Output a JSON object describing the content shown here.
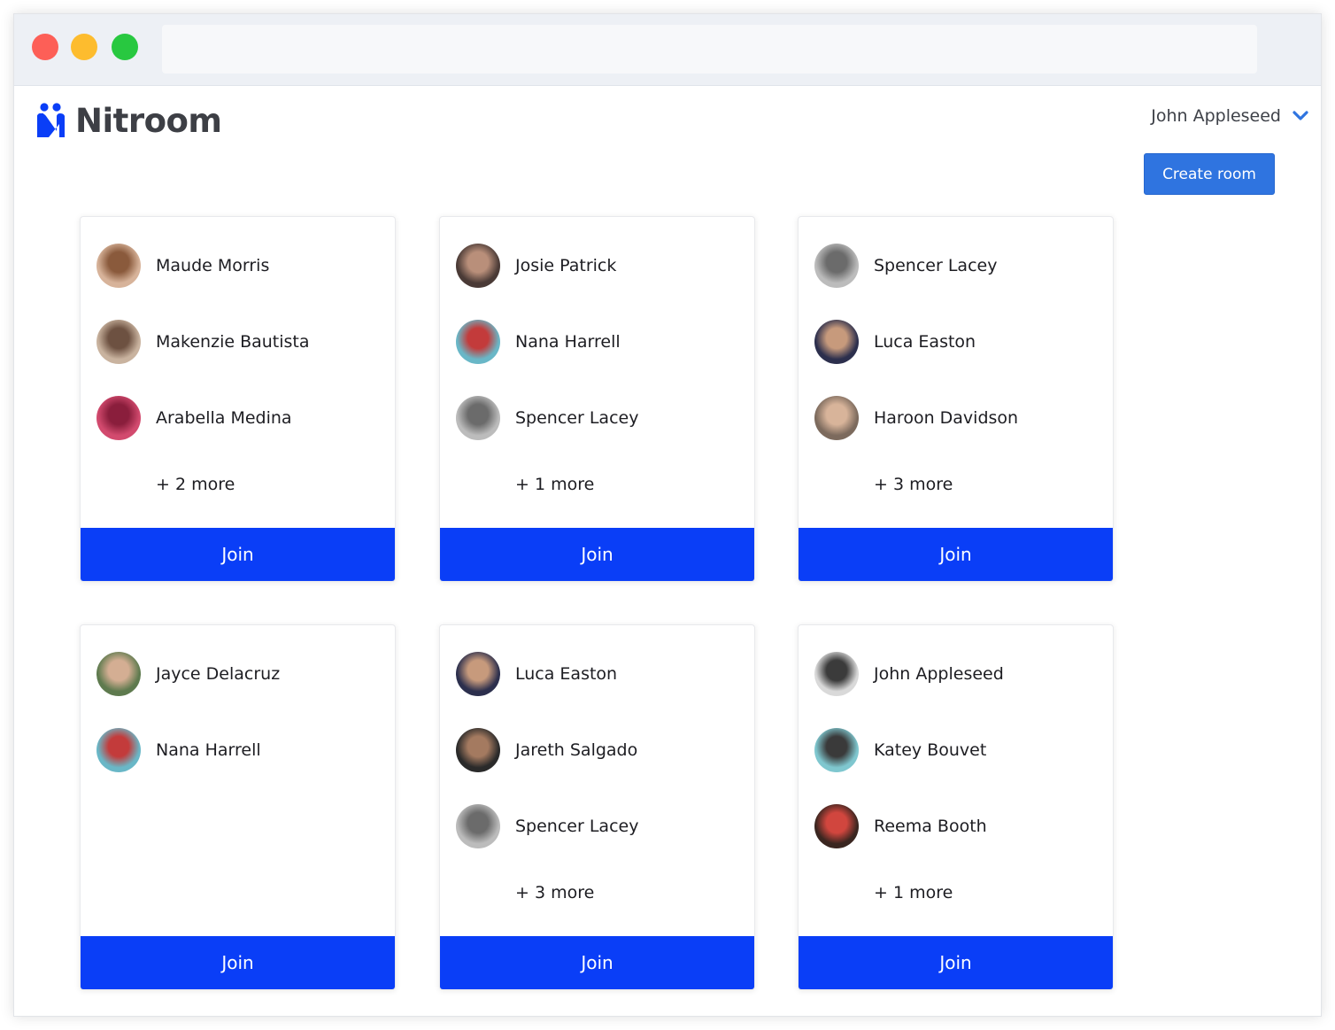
{
  "app": {
    "name": "Nitroom"
  },
  "header": {
    "user_name": "John Appleseed",
    "create_room_label": "Create room"
  },
  "colors": {
    "brand": "#0a3ef7",
    "create_button": "#2f74e0",
    "logo_text": "#3d3f45"
  },
  "rooms": [
    {
      "members": [
        {
          "name": "Maude Morris",
          "avatar_color": "#d7b39a",
          "avatar_accent": "#8a5a3c"
        },
        {
          "name": "Makenzie Bautista",
          "avatar_color": "#c9b39f",
          "avatar_accent": "#6d5141"
        },
        {
          "name": "Arabella Medina",
          "avatar_color": "#d24a6e",
          "avatar_accent": "#8a1e3c"
        }
      ],
      "more": "+ 2 more",
      "join_label": "Join"
    },
    {
      "members": [
        {
          "name": "Josie Patrick",
          "avatar_color": "#4a3a36",
          "avatar_accent": "#b98f7a"
        },
        {
          "name": "Nana Harrell",
          "avatar_color": "#69b7c7",
          "avatar_accent": "#c33b3b"
        },
        {
          "name": "Spencer Lacey",
          "avatar_color": "#bcbcbc",
          "avatar_accent": "#6b6b6b"
        }
      ],
      "more": "+ 1 more",
      "join_label": "Join"
    },
    {
      "members": [
        {
          "name": "Spencer Lacey",
          "avatar_color": "#bcbcbc",
          "avatar_accent": "#6b6b6b"
        },
        {
          "name": "Luca Easton",
          "avatar_color": "#2c2f4d",
          "avatar_accent": "#c79a7c"
        },
        {
          "name": "Haroon Davidson",
          "avatar_color": "#7c6a5d",
          "avatar_accent": "#d8b49a"
        }
      ],
      "more": "+ 3 more",
      "join_label": "Join"
    },
    {
      "members": [
        {
          "name": "Jayce Delacruz",
          "avatar_color": "#5e7a4e",
          "avatar_accent": "#d4ae93"
        },
        {
          "name": "Nana Harrell",
          "avatar_color": "#69b7c7",
          "avatar_accent": "#c33b3b"
        }
      ],
      "more": "",
      "join_label": "Join"
    },
    {
      "members": [
        {
          "name": "Luca Easton",
          "avatar_color": "#2c2f4d",
          "avatar_accent": "#c79a7c"
        },
        {
          "name": "Jareth Salgado",
          "avatar_color": "#2a2a2a",
          "avatar_accent": "#a47a60"
        },
        {
          "name": "Spencer Lacey",
          "avatar_color": "#bcbcbc",
          "avatar_accent": "#6b6b6b"
        }
      ],
      "more": "+ 3 more",
      "join_label": "Join"
    },
    {
      "members": [
        {
          "name": "John Appleseed",
          "avatar_color": "#d9d9d9",
          "avatar_accent": "#3b3b3b"
        },
        {
          "name": "Katey Bouvet",
          "avatar_color": "#7fc7cf",
          "avatar_accent": "#3a3a3a"
        },
        {
          "name": "Reema Booth",
          "avatar_color": "#3a2620",
          "avatar_accent": "#d1463e"
        }
      ],
      "more": "+ 1 more",
      "join_label": "Join"
    }
  ]
}
